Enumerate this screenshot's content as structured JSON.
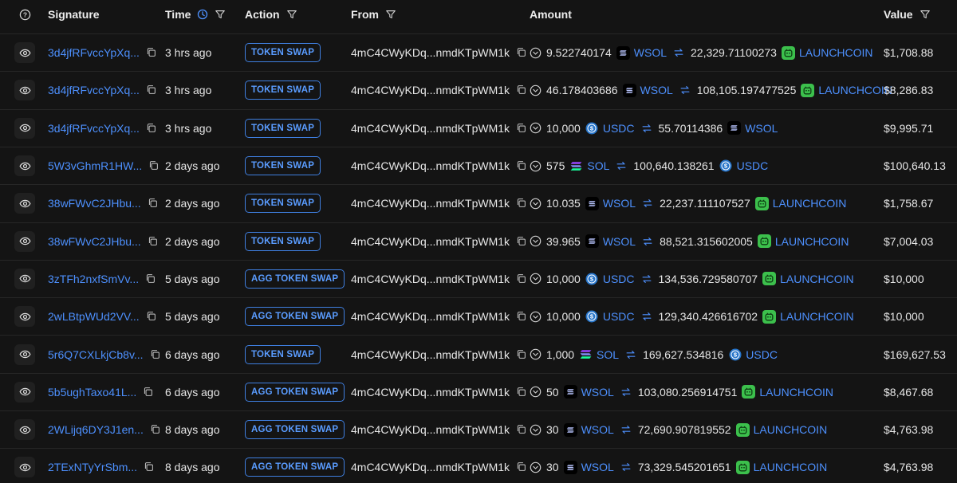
{
  "header": {
    "help_icon": "help-circle-icon",
    "signature": "Signature",
    "time": "Time",
    "action": "Action",
    "from": "From",
    "amount": "Amount",
    "value": "Value"
  },
  "colors": {
    "link": "#4d90fe",
    "badge": "#3f7fe0",
    "usdc": "#2775ca",
    "launchcoin": "#3cc04c",
    "wsol_bg": "#000000"
  },
  "rows": [
    {
      "signature": "3d4jfRFvccYpXq...",
      "time": "3 hrs ago",
      "action": "TOKEN SWAP",
      "from": "4mC4CWyKDq...nmdKTpWM1k",
      "in_amount": "9.522740174",
      "in_token": "WSOL",
      "out_amount": "22,329.71100273",
      "out_token": "LAUNCHCOIN",
      "value": "$1,708.88"
    },
    {
      "signature": "3d4jfRFvccYpXq...",
      "time": "3 hrs ago",
      "action": "TOKEN SWAP",
      "from": "4mC4CWyKDq...nmdKTpWM1k",
      "in_amount": "46.178403686",
      "in_token": "WSOL",
      "out_amount": "108,105.197477525",
      "out_token": "LAUNCHCOIN",
      "value": "$8,286.83"
    },
    {
      "signature": "3d4jfRFvccYpXq...",
      "time": "3 hrs ago",
      "action": "TOKEN SWAP",
      "from": "4mC4CWyKDq...nmdKTpWM1k",
      "in_amount": "10,000",
      "in_token": "USDC",
      "out_amount": "55.70114386",
      "out_token": "WSOL",
      "value": "$9,995.71"
    },
    {
      "signature": "5W3vGhmR1HW...",
      "time": "2 days ago",
      "action": "TOKEN SWAP",
      "from": "4mC4CWyKDq...nmdKTpWM1k",
      "in_amount": "575",
      "in_token": "SOL",
      "out_amount": "100,640.138261",
      "out_token": "USDC",
      "value": "$100,640.13"
    },
    {
      "signature": "38wFWvC2JHbu...",
      "time": "2 days ago",
      "action": "TOKEN SWAP",
      "from": "4mC4CWyKDq...nmdKTpWM1k",
      "in_amount": "10.035",
      "in_token": "WSOL",
      "out_amount": "22,237.111107527",
      "out_token": "LAUNCHCOIN",
      "value": "$1,758.67"
    },
    {
      "signature": "38wFWvC2JHbu...",
      "time": "2 days ago",
      "action": "TOKEN SWAP",
      "from": "4mC4CWyKDq...nmdKTpWM1k",
      "in_amount": "39.965",
      "in_token": "WSOL",
      "out_amount": "88,521.315602005",
      "out_token": "LAUNCHCOIN",
      "value": "$7,004.03"
    },
    {
      "signature": "3zTFh2nxfSmVv...",
      "time": "5 days ago",
      "action": "AGG TOKEN SWAP",
      "from": "4mC4CWyKDq...nmdKTpWM1k",
      "in_amount": "10,000",
      "in_token": "USDC",
      "out_amount": "134,536.729580707",
      "out_token": "LAUNCHCOIN",
      "value": "$10,000"
    },
    {
      "signature": "2wLBtpWUd2VV...",
      "time": "5 days ago",
      "action": "AGG TOKEN SWAP",
      "from": "4mC4CWyKDq...nmdKTpWM1k",
      "in_amount": "10,000",
      "in_token": "USDC",
      "out_amount": "129,340.426616702",
      "out_token": "LAUNCHCOIN",
      "value": "$10,000"
    },
    {
      "signature": "5r6Q7CXLkjCb8v...",
      "time": "6 days ago",
      "action": "TOKEN SWAP",
      "from": "4mC4CWyKDq...nmdKTpWM1k",
      "in_amount": "1,000",
      "in_token": "SOL",
      "out_amount": "169,627.534816",
      "out_token": "USDC",
      "value": "$169,627.53"
    },
    {
      "signature": "5b5ughTaxo41L...",
      "time": "6 days ago",
      "action": "AGG TOKEN SWAP",
      "from": "4mC4CWyKDq...nmdKTpWM1k",
      "in_amount": "50",
      "in_token": "WSOL",
      "out_amount": "103,080.256914751",
      "out_token": "LAUNCHCOIN",
      "value": "$8,467.68"
    },
    {
      "signature": "2WLijq6DY3J1en...",
      "time": "8 days ago",
      "action": "AGG TOKEN SWAP",
      "from": "4mC4CWyKDq...nmdKTpWM1k",
      "in_amount": "30",
      "in_token": "WSOL",
      "out_amount": "72,690.907819552",
      "out_token": "LAUNCHCOIN",
      "value": "$4,763.98"
    },
    {
      "signature": "2TExNTyYrSbm...",
      "time": "8 days ago",
      "action": "AGG TOKEN SWAP",
      "from": "4mC4CWyKDq...nmdKTpWM1k",
      "in_amount": "30",
      "in_token": "WSOL",
      "out_amount": "73,329.545201651",
      "out_token": "LAUNCHCOIN",
      "value": "$4,763.98"
    }
  ]
}
